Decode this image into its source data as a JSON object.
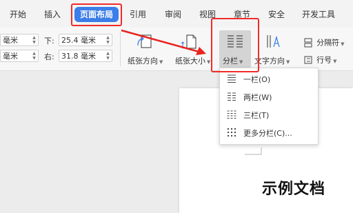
{
  "menu": {
    "tabs": [
      {
        "label": "开始"
      },
      {
        "label": "插入"
      },
      {
        "label": "页面布局"
      },
      {
        "label": "引用"
      },
      {
        "label": "审阅"
      },
      {
        "label": "视图"
      },
      {
        "label": "章节"
      },
      {
        "label": "安全"
      },
      {
        "label": "开发工具"
      }
    ],
    "active_index": 2
  },
  "ribbon": {
    "margins": {
      "top_left_value": "毫米",
      "bottom_left_value": "毫米",
      "bottom_label": "下:",
      "bottom_value": "25.4 毫米",
      "right_label": "右:",
      "right_value": "31.8 毫米"
    },
    "buttons": {
      "orientation": "纸张方向",
      "size": "纸张大小",
      "columns": "分栏",
      "text_direction": "文字方向",
      "separator": "分隔符",
      "line_number": "行号"
    }
  },
  "dropdown": {
    "items": [
      {
        "label": "一栏(O)"
      },
      {
        "label": "两栏(W)"
      },
      {
        "label": "三栏(T)"
      },
      {
        "label": "更多分栏(C)..."
      }
    ]
  },
  "document": {
    "text": "示例文档"
  },
  "colors": {
    "accent": "#3b7de9",
    "highlight": "#f02a2a"
  }
}
